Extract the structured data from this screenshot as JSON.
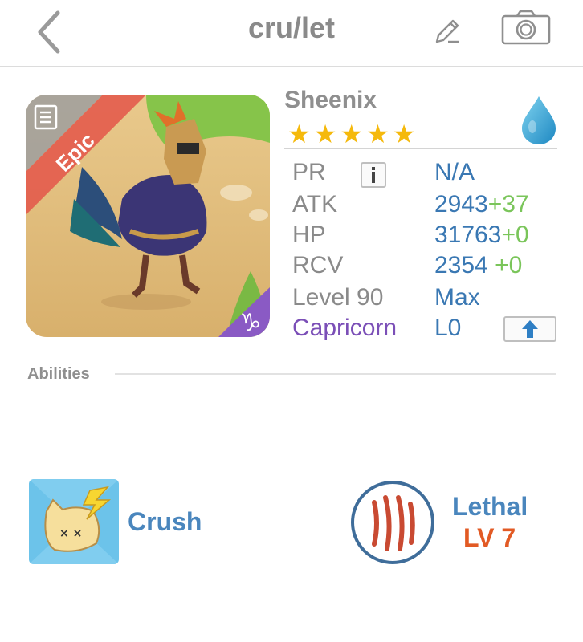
{
  "header": {
    "title": "cru/let",
    "back_icon": "chevron-left-icon",
    "edit_icon": "pencil-icon",
    "camera_icon": "camera-icon"
  },
  "monster": {
    "rarity": "Epic",
    "name": "Sheenix",
    "stars": 5,
    "element_icon": "water-drop-icon",
    "zodiac_badge": "capricorn-badge-icon"
  },
  "stats": {
    "pr_label": "PR",
    "pr_value": "N/A",
    "atk_label": "ATK",
    "atk_value": "2943",
    "atk_bonus": "+37",
    "hp_label": "HP",
    "hp_value": "31763",
    "hp_bonus": "+0",
    "rcv_label": "RCV",
    "rcv_value": "2354",
    "rcv_bonus": "+0",
    "level_label": "Level 90",
    "level_value": "Max",
    "zodiac_label": "Capricorn",
    "zodiac_value": "L0"
  },
  "abilities": {
    "section_label": "Abilities",
    "items": [
      {
        "name": "Crush",
        "icon": "crush-icon"
      },
      {
        "name": "Lethal",
        "level": "LV 7",
        "icon": "claw-marks-icon"
      }
    ]
  },
  "colors": {
    "star": "#f5b90c",
    "stat_value": "#3a78b3",
    "bonus": "#7ac55a",
    "zodiac": "#7b4fb7",
    "ability_level": "#e25a24"
  }
}
